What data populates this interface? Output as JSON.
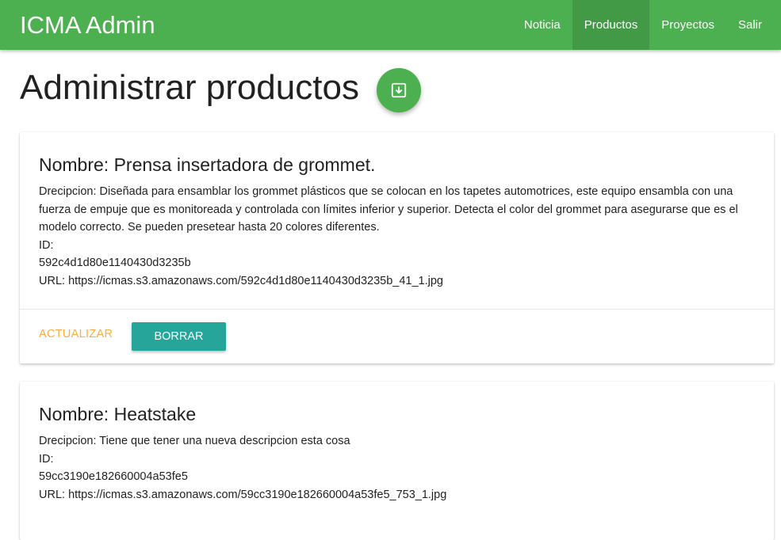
{
  "app": {
    "brand": "ICMA Admin",
    "nav": [
      {
        "label": "Noticia"
      },
      {
        "label": "Productos"
      },
      {
        "label": "Proyectos"
      },
      {
        "label": "Salir"
      }
    ]
  },
  "page": {
    "title": "Administrar productos",
    "fab_icon": "download-icon"
  },
  "products": [
    {
      "name": "Nombre: Prensa insertadora de grommet.",
      "description": "Drecipcion: Diseñada para ensamblar los grommet plásticos que se colocan en los tapetes automotrices, este equipo ensambla con una fuerza de empuje que es monitoreada y controlada con límites inferior y superior. Detecta el color del grommet para asegurarse que es el modelo correcto. Se pueden presetear hasta 20 colores diferentes.",
      "id_label": "ID:",
      "id": "592c4d1d80e1140430d3235b",
      "url": "URL: https://icmas.s3.amazonaws.com/592c4d1d80e1140430d3235b_41_1.jpg",
      "update_label": "Actualizar",
      "delete_label": "Borrar"
    },
    {
      "name": "Nombre: Heatstake",
      "description": "Drecipcion: Tiene que tener una nueva descripcion esta cosa",
      "id_label": "ID:",
      "id": "59cc3190e182660004a53fe5",
      "url": "URL: https://icmas.s3.amazonaws.com/59cc3190e182660004a53fe5_753_1.jpg"
    }
  ],
  "colors": {
    "primary": "#4caf50",
    "teal": "#26a69a",
    "orange": "#ffab40"
  }
}
